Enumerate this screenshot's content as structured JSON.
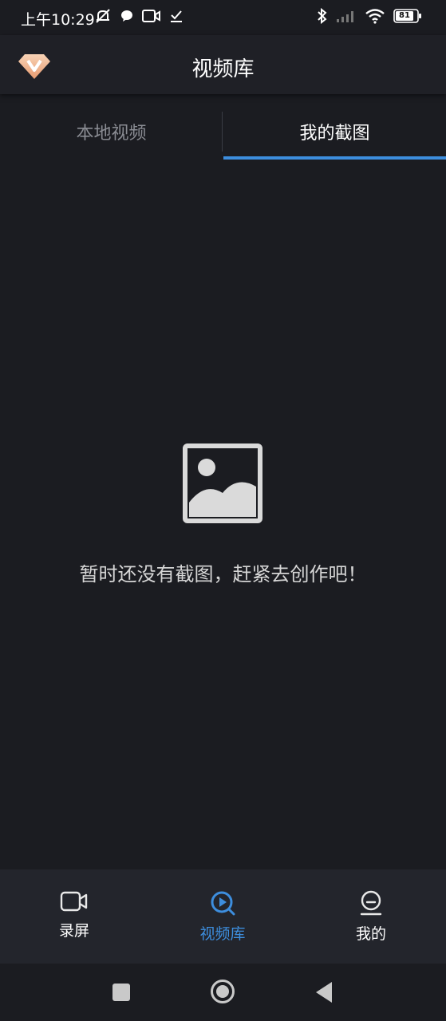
{
  "status_bar": {
    "time": "上午10:29",
    "battery": "81"
  },
  "header": {
    "title": "视频库",
    "logo_icon": "diamond-v-logo"
  },
  "tabs": [
    {
      "label": "本地视频",
      "active": false
    },
    {
      "label": "我的截图",
      "active": true
    }
  ],
  "empty_state": {
    "icon": "image-placeholder-icon",
    "message": "暂时还没有截图，赶紧去创作吧！"
  },
  "bottom_nav": [
    {
      "label": "录屏",
      "icon": "video-camera-icon",
      "active": false
    },
    {
      "label": "视频库",
      "icon": "video-library-icon",
      "active": true
    },
    {
      "label": "我的",
      "icon": "profile-icon",
      "active": false
    }
  ],
  "colors": {
    "background": "#1b1c21",
    "header": "#1f2026",
    "accent": "#3d8ede",
    "inactive_tab": "#8a8c93",
    "bottom_nav": "#23252c"
  }
}
